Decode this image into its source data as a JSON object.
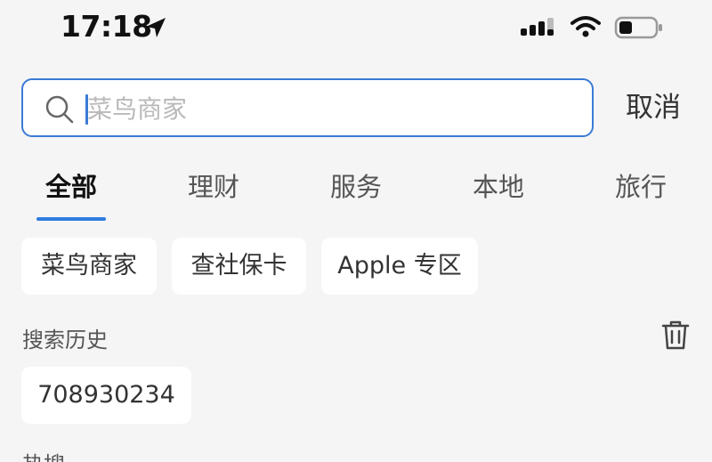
{
  "status_bar": {
    "time": "17:18",
    "location_icon": "location-arrow-icon",
    "signal_icon": "cellular-signal-icon",
    "wifi_icon": "wifi-icon",
    "battery_icon": "battery-icon"
  },
  "search": {
    "placeholder": "菜鸟商家",
    "value": "",
    "icon": "search-icon",
    "accent_color": "#3a7bd5"
  },
  "cancel_label": "取消",
  "tabs": [
    {
      "label": "全部",
      "active": true
    },
    {
      "label": "理财",
      "active": false
    },
    {
      "label": "服务",
      "active": false
    },
    {
      "label": "本地",
      "active": false
    },
    {
      "label": "旅行",
      "active": false
    }
  ],
  "suggestions": [
    "菜鸟商家",
    "查社保卡",
    "Apple 专区"
  ],
  "history": {
    "title": "搜索历史",
    "delete_icon": "trash-icon",
    "items": [
      "708930234"
    ]
  },
  "next_section_title": "热搜"
}
